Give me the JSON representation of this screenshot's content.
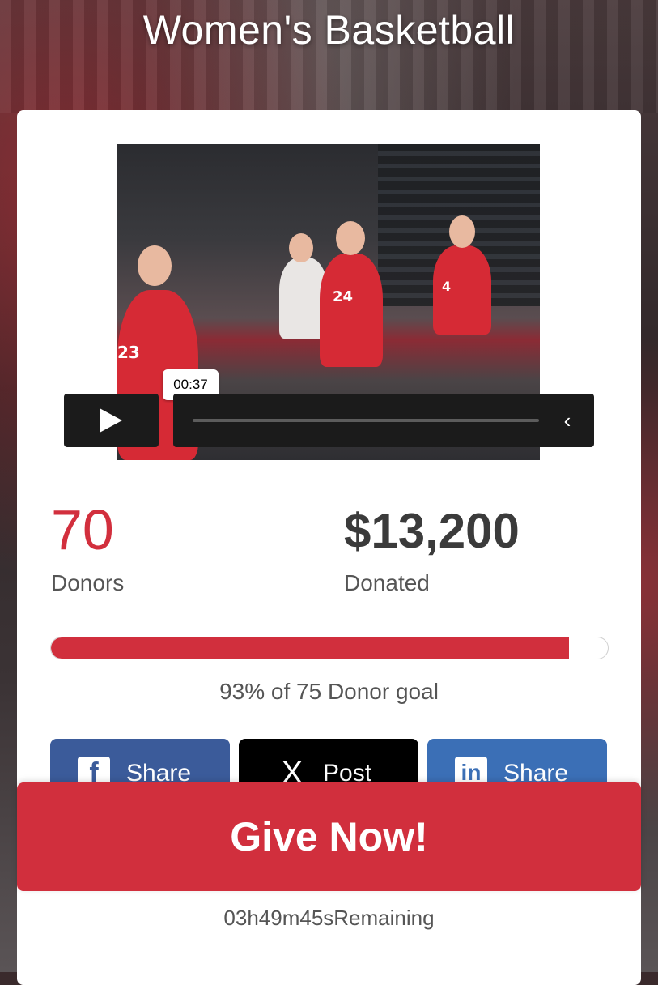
{
  "page": {
    "title": "Women's Basketball"
  },
  "video": {
    "timestamp": "00:37",
    "jersey_numbers": [
      "24",
      "23",
      "4"
    ],
    "controls": {
      "play_icon": "play-icon",
      "collapse_icon": "chevron-left-icon"
    }
  },
  "stats": {
    "donors_count": "70",
    "donors_label": "Donors",
    "donated_amount": "$13,200",
    "donated_label": "Donated"
  },
  "progress": {
    "percent": 93,
    "goal_text": "93% of 75 Donor goal",
    "fill_color": "#d12f3d"
  },
  "share": {
    "buttons": [
      {
        "label": "Share",
        "icon": "facebook-icon",
        "color": "#3b5b9a"
      },
      {
        "label": "Post",
        "icon": "x-icon",
        "color": "#000000"
      },
      {
        "label": "Share",
        "icon": "linkedin-icon",
        "color": "#3b6fb6"
      }
    ]
  },
  "cta": {
    "give_label": "Give Now!",
    "color": "#d12f3d"
  },
  "countdown": {
    "text": "03h49m45sRemaining"
  }
}
